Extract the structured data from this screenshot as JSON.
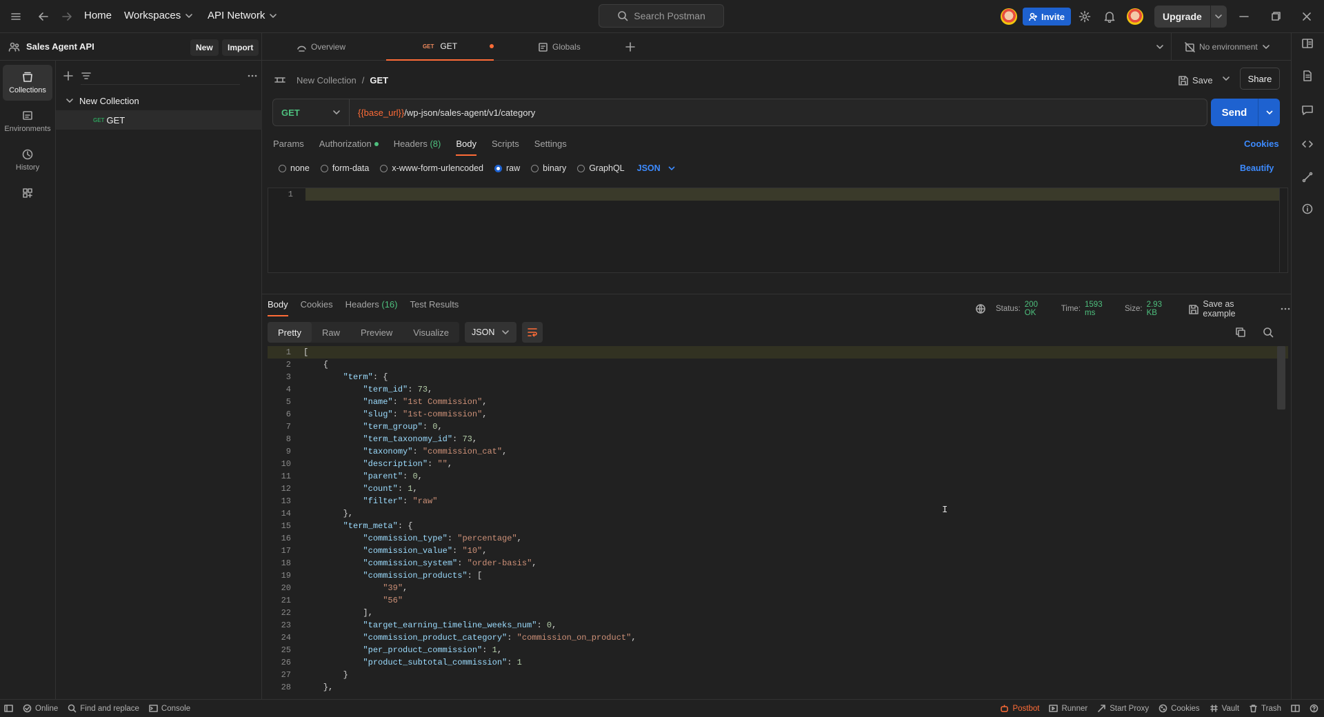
{
  "topbar": {
    "home": "Home",
    "workspaces": "Workspaces",
    "api_network": "API Network",
    "search_placeholder": "Search Postman",
    "invite": "Invite",
    "upgrade": "Upgrade"
  },
  "sidebar": {
    "workspace_name": "Sales Agent API",
    "new_label": "New",
    "import_label": "Import",
    "rail": [
      {
        "label": "Collections",
        "icon": "collections-icon"
      },
      {
        "label": "Environments",
        "icon": "environments-icon"
      },
      {
        "label": "History",
        "icon": "history-icon"
      }
    ],
    "collection_name": "New Collection",
    "request_method": "GET",
    "request_name": "GET"
  },
  "tabs": {
    "overview": "Overview",
    "active_method": "GET",
    "active_name": "GET",
    "globals": "Globals",
    "environment": "No environment"
  },
  "request": {
    "breadcrumb_collection": "New Collection",
    "breadcrumb_sep": "/",
    "breadcrumb_request": "GET",
    "save": "Save",
    "share": "Share",
    "method": "GET",
    "url_var": "{{base_url}}",
    "url_path": "/wp-json/sales-agent/v1/category",
    "send": "Send",
    "subtabs": {
      "params": "Params",
      "authorization": "Authorization",
      "headers": "Headers",
      "headers_count": "(8)",
      "body": "Body",
      "scripts": "Scripts",
      "settings": "Settings"
    },
    "cookies": "Cookies",
    "body_types": [
      "none",
      "form-data",
      "x-www-form-urlencoded",
      "raw",
      "binary",
      "GraphQL"
    ],
    "body_selected": "raw",
    "body_lang": "JSON",
    "beautify": "Beautify",
    "editor_line": "1"
  },
  "response": {
    "tabs": {
      "body": "Body",
      "cookies": "Cookies",
      "headers": "Headers",
      "headers_count": "(16)",
      "tests": "Test Results"
    },
    "status_label": "Status:",
    "status_value": "200 OK",
    "time_label": "Time:",
    "time_value": "1593 ms",
    "size_label": "Size:",
    "size_value": "2.93 KB",
    "save_example": "Save as example",
    "views": [
      "Pretty",
      "Raw",
      "Preview",
      "Visualize"
    ],
    "format": "JSON"
  },
  "code_lines": [
    "[",
    "    {",
    "        \"term\": {",
    "            \"term_id\": 73,",
    "            \"name\": \"1st Commission\",",
    "            \"slug\": \"1st-commission\",",
    "            \"term_group\": 0,",
    "            \"term_taxonomy_id\": 73,",
    "            \"taxonomy\": \"commission_cat\",",
    "            \"description\": \"\",",
    "            \"parent\": 0,",
    "            \"count\": 1,",
    "            \"filter\": \"raw\"",
    "        },",
    "        \"term_meta\": {",
    "            \"commission_type\": \"percentage\",",
    "            \"commission_value\": \"10\",",
    "            \"commission_system\": \"order-basis\",",
    "            \"commission_products\": [",
    "                \"39\",",
    "                \"56\"",
    "            ],",
    "            \"target_earning_timeline_weeks_num\": 0,",
    "            \"commission_product_category\": \"commission_on_product\",",
    "            \"per_product_commission\": 1,",
    "            \"product_subtotal_commission\": 1",
    "        }",
    "    },"
  ],
  "statusbar": {
    "online": "Online",
    "find_replace": "Find and replace",
    "console": "Console",
    "postbot": "Postbot",
    "runner": "Runner",
    "start_proxy": "Start Proxy",
    "cookies": "Cookies",
    "vault": "Vault",
    "trash": "Trash"
  },
  "colors": {
    "accent": "#ff6c37",
    "primary": "#1e62d0",
    "status_ok": "#4ec07e"
  }
}
